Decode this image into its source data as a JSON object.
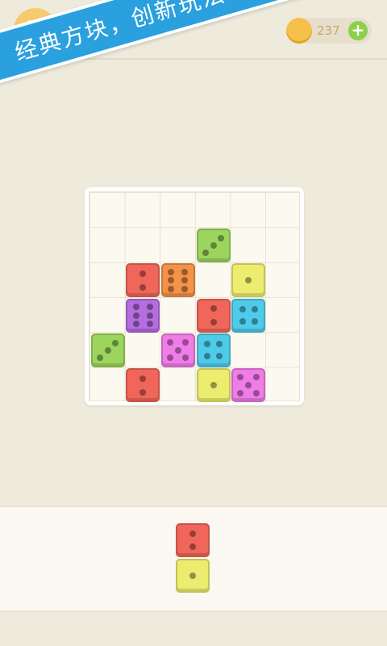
{
  "header": {
    "coins": "237",
    "add_label": "+",
    "banner": "经典方块，创新玩法！"
  },
  "colors": {
    "red": "#f0665a",
    "orange": "#f4924a",
    "yellow": "#ecec6e",
    "green": "#9cd55d",
    "purple": "#b56de0",
    "pink": "#f07ce8",
    "cyan": "#4fcbea"
  },
  "board": {
    "rows": 6,
    "cols": 6,
    "dice": [
      {
        "row": 1,
        "col": 3,
        "color": "green",
        "value": 3
      },
      {
        "row": 2,
        "col": 1,
        "color": "red",
        "value": 2
      },
      {
        "row": 2,
        "col": 2,
        "color": "orange",
        "value": 6
      },
      {
        "row": 2,
        "col": 4,
        "color": "yellow",
        "value": 1
      },
      {
        "row": 3,
        "col": 1,
        "color": "purple",
        "value": 6
      },
      {
        "row": 3,
        "col": 3,
        "color": "red",
        "value": 2
      },
      {
        "row": 3,
        "col": 4,
        "color": "cyan",
        "value": 4
      },
      {
        "row": 4,
        "col": 0,
        "color": "green",
        "value": 3
      },
      {
        "row": 4,
        "col": 2,
        "color": "pink",
        "value": 5
      },
      {
        "row": 4,
        "col": 3,
        "color": "cyan",
        "value": 4
      },
      {
        "row": 5,
        "col": 1,
        "color": "red",
        "value": 2
      },
      {
        "row": 5,
        "col": 3,
        "color": "yellow",
        "value": 1
      },
      {
        "row": 5,
        "col": 4,
        "color": "pink",
        "value": 5
      }
    ]
  },
  "tray": {
    "piece": [
      {
        "color": "red",
        "value": 2
      },
      {
        "color": "yellow",
        "value": 1
      }
    ]
  }
}
